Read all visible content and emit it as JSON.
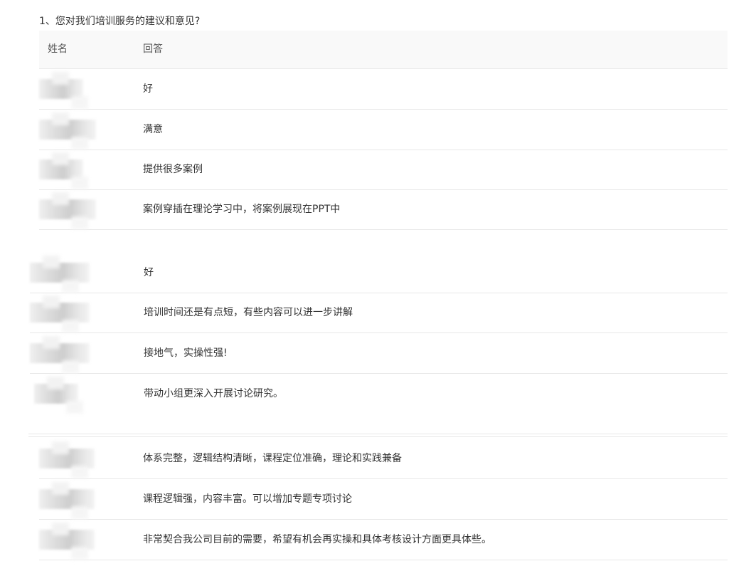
{
  "question": {
    "title": "1、您对我们培训服务的建议和意见?"
  },
  "table": {
    "header": {
      "name": "姓名",
      "answer": "回答"
    },
    "groups": [
      {
        "answers": [
          "好",
          "满意",
          "提供很多案例",
          "案例穿插在理论学习中，将案例展现在PPT中"
        ]
      },
      {
        "answers": [
          "好",
          "培训时间还是有点短，有些内容可以进一步讲解",
          "接地气，实操性强!",
          "带动小组更深入开展讨论研究。"
        ]
      },
      {
        "answers": [
          "体系完整，逻辑结构清晰，课程定位准确，理论和实践兼备",
          "课程逻辑强，内容丰富。可以增加专题专项讨论",
          "非常契合我公司目前的需要，希望有机会再实操和具体考核设计方面更具体些。"
        ]
      }
    ]
  }
}
